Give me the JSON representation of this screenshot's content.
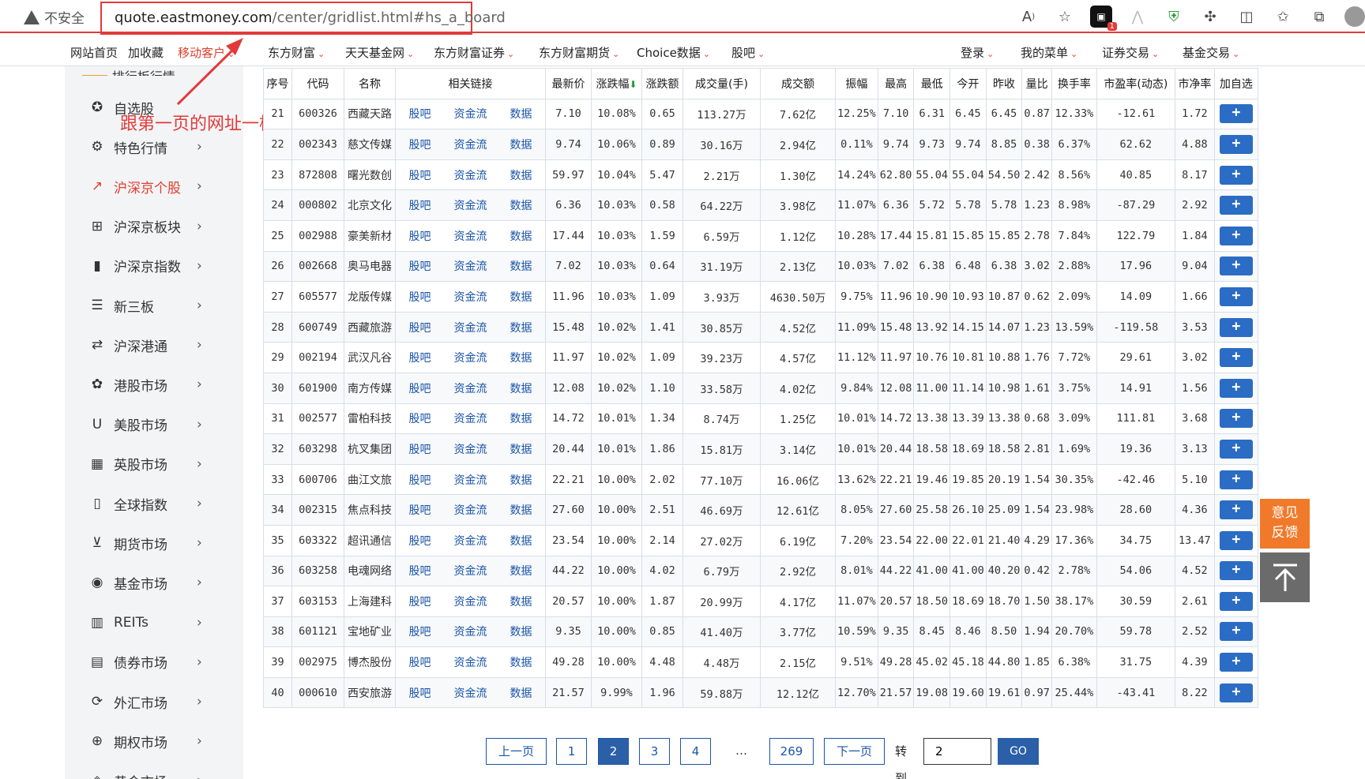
{
  "browser": {
    "insecure_label": "不安全",
    "url_host": "quote.eastmoney.com",
    "url_path": "/center/gridlist.html#hs_a_board",
    "icons": [
      "read-aloud-icon",
      "favorite-add-icon",
      "extension-icon",
      "reader-icon",
      "shield-icon",
      "puzzle-icon",
      "split-screen-icon",
      "favorites-icon",
      "collections-icon",
      "profile-avatar"
    ],
    "ext_badge": "1"
  },
  "site_nav": {
    "items": [
      {
        "label": "网站首页",
        "caret": false,
        "red": false
      },
      {
        "label": "加收藏",
        "caret": false,
        "red": false
      },
      {
        "label": "移动客户",
        "caret": true,
        "red": true
      },
      {
        "label": "东方财富",
        "caret": true,
        "red": false
      },
      {
        "label": "天天基金网",
        "caret": true,
        "red": false
      },
      {
        "label": "东方财富证券",
        "caret": true,
        "red": false
      },
      {
        "label": "东方财富期货",
        "caret": true,
        "red": false
      },
      {
        "label": "Choice数据",
        "caret": true,
        "red": false
      },
      {
        "label": "股吧",
        "caret": true,
        "red": false
      },
      {
        "label": "登录",
        "caret": true,
        "red": false
      },
      {
        "label": "我的菜单",
        "caret": true,
        "red": false
      },
      {
        "label": "证券交易",
        "caret": true,
        "red": false
      },
      {
        "label": "基金交易",
        "caret": true,
        "red": false
      }
    ]
  },
  "sidebar": {
    "top_partial": "排行板行情",
    "items": [
      {
        "label": "自选股",
        "icon": "star-circle-icon",
        "arrow": false,
        "active": false
      },
      {
        "label": "特色行情",
        "icon": "feature-icon",
        "arrow": true,
        "active": false
      },
      {
        "label": "沪深京个股",
        "icon": "trend-icon",
        "arrow": true,
        "active": true
      },
      {
        "label": "沪深京板块",
        "icon": "grid-icon",
        "arrow": true,
        "active": false
      },
      {
        "label": "沪深京指数",
        "icon": "bar-chart-icon",
        "arrow": true,
        "active": false
      },
      {
        "label": "新三板",
        "icon": "list-circle-icon",
        "arrow": true,
        "active": false
      },
      {
        "label": "沪深港通",
        "icon": "exchange-icon",
        "arrow": true,
        "active": false
      },
      {
        "label": "港股市场",
        "icon": "hk-flower-icon",
        "arrow": true,
        "active": false
      },
      {
        "label": "美股市场",
        "icon": "us-icon",
        "arrow": true,
        "active": false
      },
      {
        "label": "英股市场",
        "icon": "uk-flag-icon",
        "arrow": true,
        "active": false
      },
      {
        "label": "全球指数",
        "icon": "bookmark-icon",
        "arrow": true,
        "active": false
      },
      {
        "label": "期货市场",
        "icon": "cart-icon",
        "arrow": true,
        "active": false
      },
      {
        "label": "基金市场",
        "icon": "fund-icon",
        "arrow": true,
        "active": false
      },
      {
        "label": "REITs",
        "icon": "building-icon",
        "arrow": true,
        "active": false
      },
      {
        "label": "债券市场",
        "icon": "bond-icon",
        "arrow": true,
        "active": false
      },
      {
        "label": "外汇市场",
        "icon": "forex-icon",
        "arrow": true,
        "active": false
      },
      {
        "label": "期权市场",
        "icon": "globe-icon",
        "arrow": true,
        "active": false
      },
      {
        "label": "黄金市场",
        "icon": "gold-icon",
        "arrow": true,
        "active": false
      }
    ]
  },
  "annotation": {
    "text": "跟第一页的网址一样",
    "color": "#e23a3a"
  },
  "table": {
    "headers": [
      "序号",
      "代码",
      "名称",
      "相关链接",
      "最新价",
      "涨跌幅",
      "涨跌额",
      "成交量(手)",
      "成交额",
      "振幅",
      "最高",
      "最低",
      "今开",
      "昨收",
      "量比",
      "换手率",
      "市盈率(动态)",
      "市净率",
      "加自选"
    ],
    "link_labels": [
      "股吧",
      "资金流",
      "数据"
    ],
    "add_label": "+",
    "rows": [
      [
        "21",
        "600326",
        "西藏天路",
        "7.10",
        "10.08%",
        "0.65",
        "113.27万",
        "7.62亿",
        "12.25%",
        "7.10",
        "6.31",
        "6.45",
        "6.45",
        "0.87",
        "12.33%",
        "-12.61",
        "1.72"
      ],
      [
        "22",
        "002343",
        "慈文传媒",
        "9.74",
        "10.06%",
        "0.89",
        "30.16万",
        "2.94亿",
        "0.11%",
        "9.74",
        "9.73",
        "9.74",
        "8.85",
        "0.38",
        "6.37%",
        "62.62",
        "4.88"
      ],
      [
        "23",
        "872808",
        "曙光数创",
        "59.97",
        "10.04%",
        "5.47",
        "2.21万",
        "1.30亿",
        "14.24%",
        "62.80",
        "55.04",
        "55.04",
        "54.50",
        "2.42",
        "8.56%",
        "40.85",
        "8.17"
      ],
      [
        "24",
        "000802",
        "北京文化",
        "6.36",
        "10.03%",
        "0.58",
        "64.22万",
        "3.98亿",
        "11.07%",
        "6.36",
        "5.72",
        "5.78",
        "5.78",
        "1.23",
        "8.98%",
        "-87.29",
        "2.92"
      ],
      [
        "25",
        "002988",
        "豪美新材",
        "17.44",
        "10.03%",
        "1.59",
        "6.59万",
        "1.12亿",
        "10.28%",
        "17.44",
        "15.81",
        "15.85",
        "15.85",
        "2.78",
        "7.84%",
        "122.79",
        "1.84"
      ],
      [
        "26",
        "002668",
        "奥马电器",
        "7.02",
        "10.03%",
        "0.64",
        "31.19万",
        "2.13亿",
        "10.03%",
        "7.02",
        "6.38",
        "6.48",
        "6.38",
        "3.02",
        "2.88%",
        "17.96",
        "9.04"
      ],
      [
        "27",
        "605577",
        "龙版传媒",
        "11.96",
        "10.03%",
        "1.09",
        "3.93万",
        "4630.50万",
        "9.75%",
        "11.96",
        "10.90",
        "10.93",
        "10.87",
        "0.62",
        "2.09%",
        "14.09",
        "1.66"
      ],
      [
        "28",
        "600749",
        "西藏旅游",
        "15.48",
        "10.02%",
        "1.41",
        "30.85万",
        "4.52亿",
        "11.09%",
        "15.48",
        "13.92",
        "14.15",
        "14.07",
        "1.23",
        "13.59%",
        "-119.58",
        "3.53"
      ],
      [
        "29",
        "002194",
        "武汉凡谷",
        "11.97",
        "10.02%",
        "1.09",
        "39.23万",
        "4.57亿",
        "11.12%",
        "11.97",
        "10.76",
        "10.81",
        "10.88",
        "1.76",
        "7.72%",
        "29.61",
        "3.02"
      ],
      [
        "30",
        "601900",
        "南方传媒",
        "12.08",
        "10.02%",
        "1.10",
        "33.58万",
        "4.02亿",
        "9.84%",
        "12.08",
        "11.00",
        "11.14",
        "10.98",
        "1.61",
        "3.75%",
        "14.91",
        "1.56"
      ],
      [
        "31",
        "002577",
        "雷柏科技",
        "14.72",
        "10.01%",
        "1.34",
        "8.74万",
        "1.25亿",
        "10.01%",
        "14.72",
        "13.38",
        "13.39",
        "13.38",
        "0.68",
        "3.09%",
        "111.81",
        "3.68"
      ],
      [
        "32",
        "603298",
        "杭叉集团",
        "20.44",
        "10.01%",
        "1.86",
        "15.81万",
        "3.14亿",
        "10.01%",
        "20.44",
        "18.58",
        "18.69",
        "18.58",
        "2.81",
        "1.69%",
        "19.36",
        "3.13"
      ],
      [
        "33",
        "600706",
        "曲江文旅",
        "22.21",
        "10.00%",
        "2.02",
        "77.10万",
        "16.06亿",
        "13.62%",
        "22.21",
        "19.46",
        "19.85",
        "20.19",
        "1.54",
        "30.35%",
        "-42.46",
        "5.10"
      ],
      [
        "34",
        "002315",
        "焦点科技",
        "27.60",
        "10.00%",
        "2.51",
        "46.69万",
        "12.61亿",
        "8.05%",
        "27.60",
        "25.58",
        "26.10",
        "25.09",
        "1.54",
        "23.98%",
        "28.60",
        "4.36"
      ],
      [
        "35",
        "603322",
        "超讯通信",
        "23.54",
        "10.00%",
        "2.14",
        "27.02万",
        "6.19亿",
        "7.20%",
        "23.54",
        "22.00",
        "22.01",
        "21.40",
        "4.29",
        "17.36%",
        "34.75",
        "13.47"
      ],
      [
        "36",
        "603258",
        "电魂网络",
        "44.22",
        "10.00%",
        "4.02",
        "6.79万",
        "2.92亿",
        "8.01%",
        "44.22",
        "41.00",
        "41.00",
        "40.20",
        "0.42",
        "2.78%",
        "54.06",
        "4.52"
      ],
      [
        "37",
        "603153",
        "上海建科",
        "20.57",
        "10.00%",
        "1.87",
        "20.99万",
        "4.17亿",
        "11.07%",
        "20.57",
        "18.50",
        "18.69",
        "18.70",
        "1.50",
        "38.17%",
        "30.59",
        "2.61"
      ],
      [
        "38",
        "601121",
        "宝地矿业",
        "9.35",
        "10.00%",
        "0.85",
        "41.40万",
        "3.77亿",
        "10.59%",
        "9.35",
        "8.45",
        "8.46",
        "8.50",
        "1.94",
        "20.70%",
        "59.78",
        "2.52"
      ],
      [
        "39",
        "002975",
        "博杰股份",
        "49.28",
        "10.00%",
        "4.48",
        "4.48万",
        "2.15亿",
        "9.51%",
        "49.28",
        "45.02",
        "45.18",
        "44.80",
        "1.85",
        "6.38%",
        "31.75",
        "4.39"
      ],
      [
        "40",
        "000610",
        "西安旅游",
        "21.57",
        "9.99%",
        "1.96",
        "59.88万",
        "12.12亿",
        "12.70%",
        "21.57",
        "19.08",
        "19.60",
        "19.61",
        "0.97",
        "25.44%",
        "-43.41",
        "8.22"
      ]
    ],
    "colors": {
      "up": "#e03e2d",
      "down": "#1d9b3a",
      "flat": "#333333",
      "link": "#1b55a8"
    }
  },
  "pagination": {
    "prev_label": "上一页",
    "pages": [
      "1",
      "2",
      "3",
      "4"
    ],
    "current": "2",
    "dots": "…",
    "last_page": "269",
    "next_label": "下一页",
    "goto_label": "转到",
    "goto_value": "2",
    "go_label": "GO"
  },
  "floating": {
    "feedback_label": "意见反馈",
    "totop_icon": "back-to-top-icon"
  }
}
